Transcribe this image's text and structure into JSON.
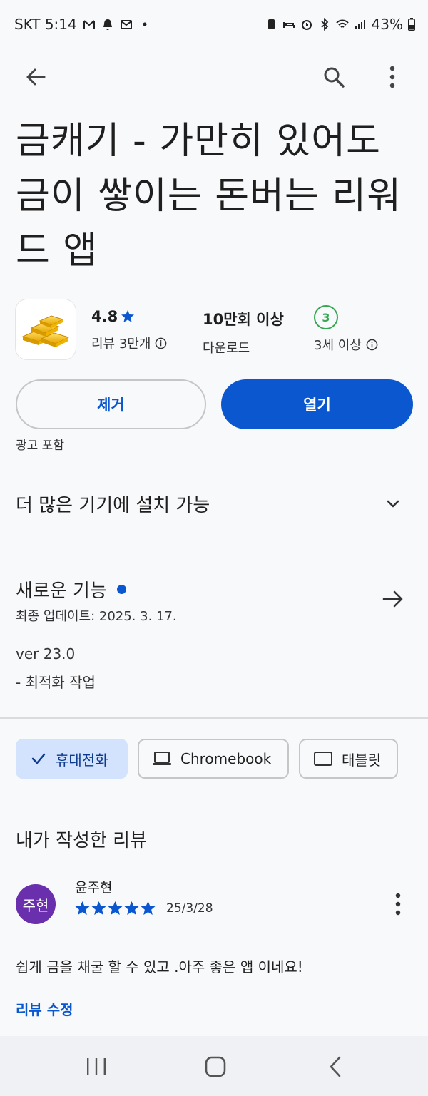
{
  "status_bar": {
    "carrier_time": "SKT 5:14",
    "battery": "43%"
  },
  "app": {
    "title": "금캐기 - 가만히 있어도 금이 쌓이는 돈버는 리워드 앱",
    "rating": "4.8",
    "rating_label": "리뷰 3만개",
    "downloads": "10만회 이상",
    "downloads_label": "다운로드",
    "age_rating_badge": "3",
    "age_rating_label": "3세 이상"
  },
  "actions": {
    "remove_label": "제거",
    "open_label": "열기",
    "ads_notice": "광고 포함"
  },
  "devices_section": {
    "title": "더 많은 기기에 설치 가능"
  },
  "whats_new": {
    "title": "새로운 기능",
    "updated": "최종 업데이트: 2025. 3. 17.",
    "version": "ver 23.0",
    "notes": "- 최적화 작업"
  },
  "device_chips": [
    {
      "label": "휴대전화",
      "selected": true
    },
    {
      "label": "Chromebook",
      "selected": false
    },
    {
      "label": "태블릿",
      "selected": false
    }
  ],
  "my_review": {
    "section_title": "내가 작성한 리뷰",
    "author": "윤주현",
    "avatar_text": "주현",
    "stars": 5,
    "date": "25/3/28",
    "text": "쉽게 금을 채굴 할 수 있고 .아주 좋은 앱 이네요!",
    "edit_label": "리뷰 수정"
  },
  "colors": {
    "accent": "#0b57d0",
    "chip_selected": "#d3e3fd",
    "avatar": "#6a2fad",
    "age_badge": "#34a853",
    "background": "#f8f9fb"
  }
}
